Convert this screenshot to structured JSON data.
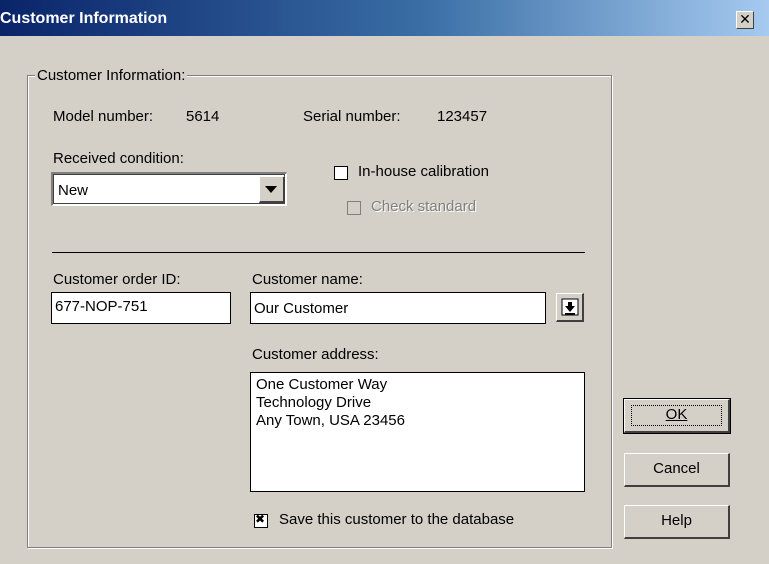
{
  "window": {
    "title": "Customer Information",
    "close_glyph": "✕"
  },
  "group": {
    "legend": "Customer Information:",
    "model_label": "Model number:",
    "model_value": "5614",
    "serial_label": "Serial number:",
    "serial_value": "123457",
    "received_label": "Received condition:",
    "received_value": "New",
    "inhouse_label": "In-house calibration",
    "inhouse_checked": false,
    "check_standard_label": "Check standard",
    "check_standard_enabled": false,
    "order_label": "Customer order ID:",
    "order_value": "677-NOP-751",
    "name_label": "Customer name:",
    "name_value": "Our Customer",
    "address_label": "Customer address:",
    "address_value": "One Customer Way\nTechnology Drive\nAny Town, USA 23456",
    "save_label": "Save this customer to the database",
    "save_checked": true
  },
  "buttons": {
    "ok_label": "OK",
    "cancel_label": "Cancel",
    "help_label": "Help"
  },
  "icons": {
    "close": "close-icon",
    "dropdown": "chevron-down-icon",
    "lookup": "down-arrow-icon"
  }
}
